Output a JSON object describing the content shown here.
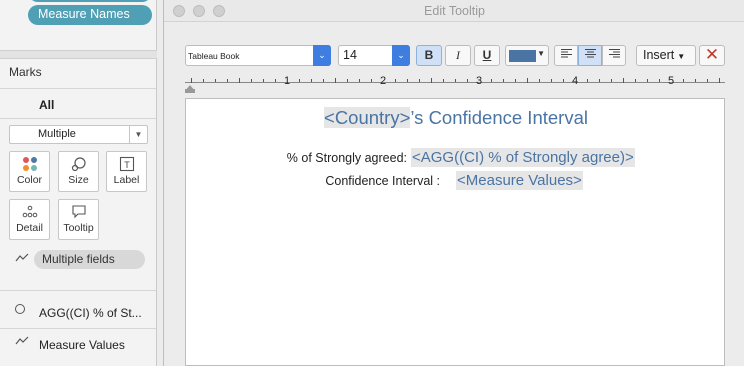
{
  "left_panel": {
    "top_pill": "Measure Names",
    "marks_title": "Marks",
    "all_label": "All",
    "mark_type": "Multiple",
    "buttons": {
      "color": "Color",
      "size": "Size",
      "label": "Label",
      "detail": "Detail",
      "tooltip": "Tooltip"
    },
    "multiple_fields": "Multiple fields",
    "fields": [
      "AGG((CI) % of St...",
      "Measure Values"
    ]
  },
  "dialog": {
    "title": "Edit Tooltip",
    "toolbar": {
      "font_family": "Tableau Book",
      "font_size": "14",
      "bold": "B",
      "italic": "I",
      "underline": "U",
      "text_color": "#4a74a4",
      "insert": "Insert"
    },
    "ruler_numbers": [
      "1",
      "2",
      "3",
      "4",
      "5"
    ],
    "editor": {
      "title_field": "<Country>",
      "title_rest": "’s Confidence Interval",
      "line1_label": "% of Strongly agreed:",
      "line1_field": "<AGG((CI) % of Strongly agree)>",
      "line2_label": "Confidence Interval :",
      "line2_field": "<Measure Values>"
    }
  }
}
